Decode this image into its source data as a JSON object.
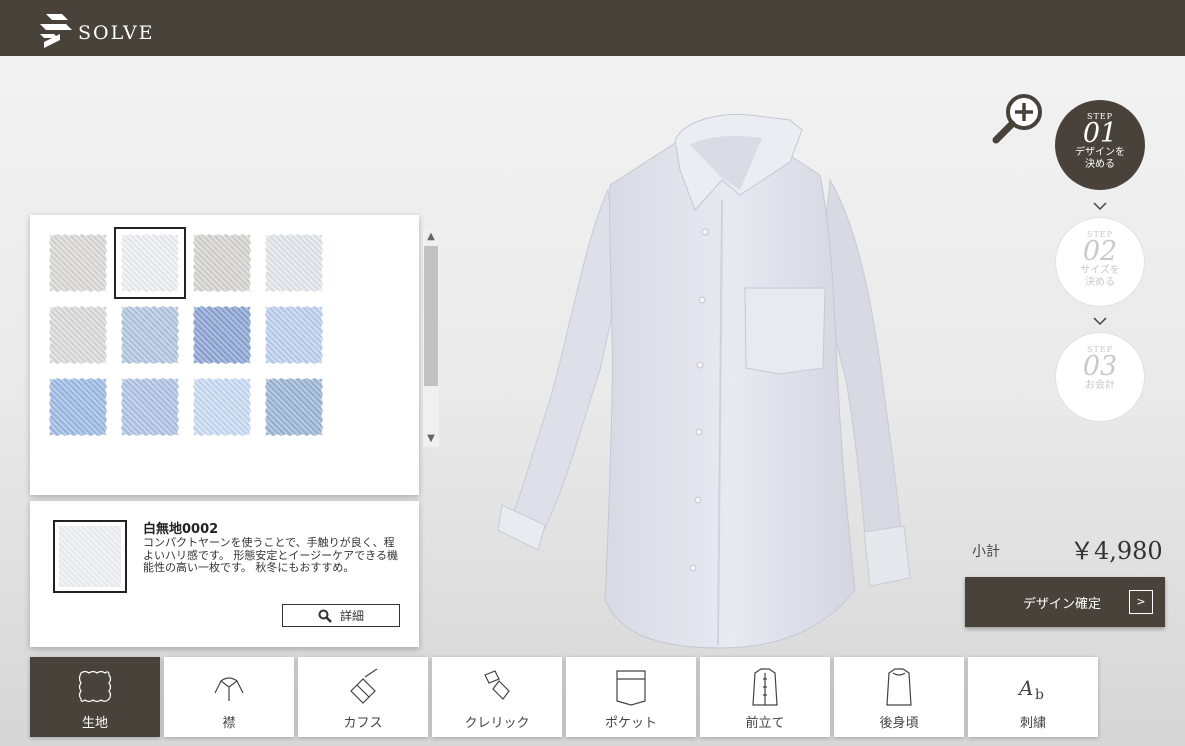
{
  "brand": {
    "name": "SOLVE"
  },
  "swatches": [
    {
      "name": "fabric-1",
      "color": "#dcdad7",
      "selected": false
    },
    {
      "name": "fabric-2",
      "color": "#eef0f4",
      "selected": true
    },
    {
      "name": "fabric-3",
      "color": "#d7d5d3",
      "selected": false
    },
    {
      "name": "fabric-4",
      "color": "#e3e7ec",
      "selected": false
    },
    {
      "name": "fabric-5",
      "color": "#dcdbdb",
      "selected": false
    },
    {
      "name": "fabric-6",
      "color": "#b5c8e0",
      "selected": false
    },
    {
      "name": "fabric-7",
      "color": "#8ea6d6",
      "selected": false
    },
    {
      "name": "fabric-8",
      "color": "#bfd0f0",
      "selected": false
    },
    {
      "name": "fabric-9",
      "color": "#9ebde6",
      "selected": false
    },
    {
      "name": "fabric-10",
      "color": "#b1c5e6",
      "selected": false
    },
    {
      "name": "fabric-11",
      "color": "#c9dcf4",
      "selected": false
    },
    {
      "name": "fabric-12",
      "color": "#9db7d6",
      "selected": false
    }
  ],
  "detail": {
    "name": "白無地0002",
    "description": "コンパクトヤーンを使うことで、手触りが良く、程よいハリ感です。 形態安定とイージーケアできる機能性の高い一枚です。 秋冬にもおすすめ。",
    "button_label": "詳細"
  },
  "steps": [
    {
      "label": "STEP",
      "number": "01",
      "line1": "デザインを",
      "line2": "決める",
      "active": true
    },
    {
      "label": "STEP",
      "number": "02",
      "line1": "サイズを",
      "line2": "決める",
      "active": false
    },
    {
      "label": "STEP",
      "number": "03",
      "line1": "お会計",
      "line2": "",
      "active": false
    }
  ],
  "price": {
    "label": "小計",
    "value": "￥4,980"
  },
  "confirm": {
    "label": "デザイン確定",
    "arrow": ">"
  },
  "tabs": [
    {
      "label": "生地",
      "icon": "fabric-icon",
      "active": true
    },
    {
      "label": "襟",
      "icon": "collar-icon",
      "active": false
    },
    {
      "label": "カフス",
      "icon": "cuffs-icon",
      "active": false
    },
    {
      "label": "クレリック",
      "icon": "cleric-icon",
      "active": false
    },
    {
      "label": "ポケット",
      "icon": "pocket-icon",
      "active": false
    },
    {
      "label": "前立て",
      "icon": "placket-icon",
      "active": false
    },
    {
      "label": "後身頃",
      "icon": "back-body-icon",
      "active": false
    },
    {
      "label": "刺繍",
      "icon": "embroidery-icon",
      "active": false
    }
  ],
  "colors": {
    "brand_dark": "#48423a",
    "accent_white": "#ffffff"
  }
}
